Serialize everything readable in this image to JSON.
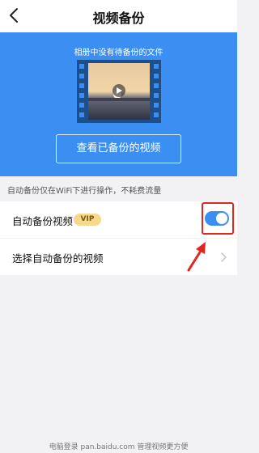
{
  "header": {
    "title": "视频备份",
    "back_icon": "chevron-left-icon"
  },
  "hero": {
    "caption": "相册中没有待备份的文件",
    "button_label": "查看已备份的视频",
    "background_color": "#3b8ff2",
    "illustration_icon": "film-strip-play-icon"
  },
  "notice": "自动备份仅在WiFi下进行操作，不耗费流量",
  "settings": [
    {
      "label": "自动备份视频",
      "badge": "VIP",
      "control": "toggle",
      "enabled": true
    },
    {
      "label": "选择自动备份的视频",
      "control": "chevron-right-icon"
    }
  ],
  "annotation": {
    "color": "#e0261f"
  },
  "footer": "电脑登录 pan.baidu.com 管理视频更方便"
}
